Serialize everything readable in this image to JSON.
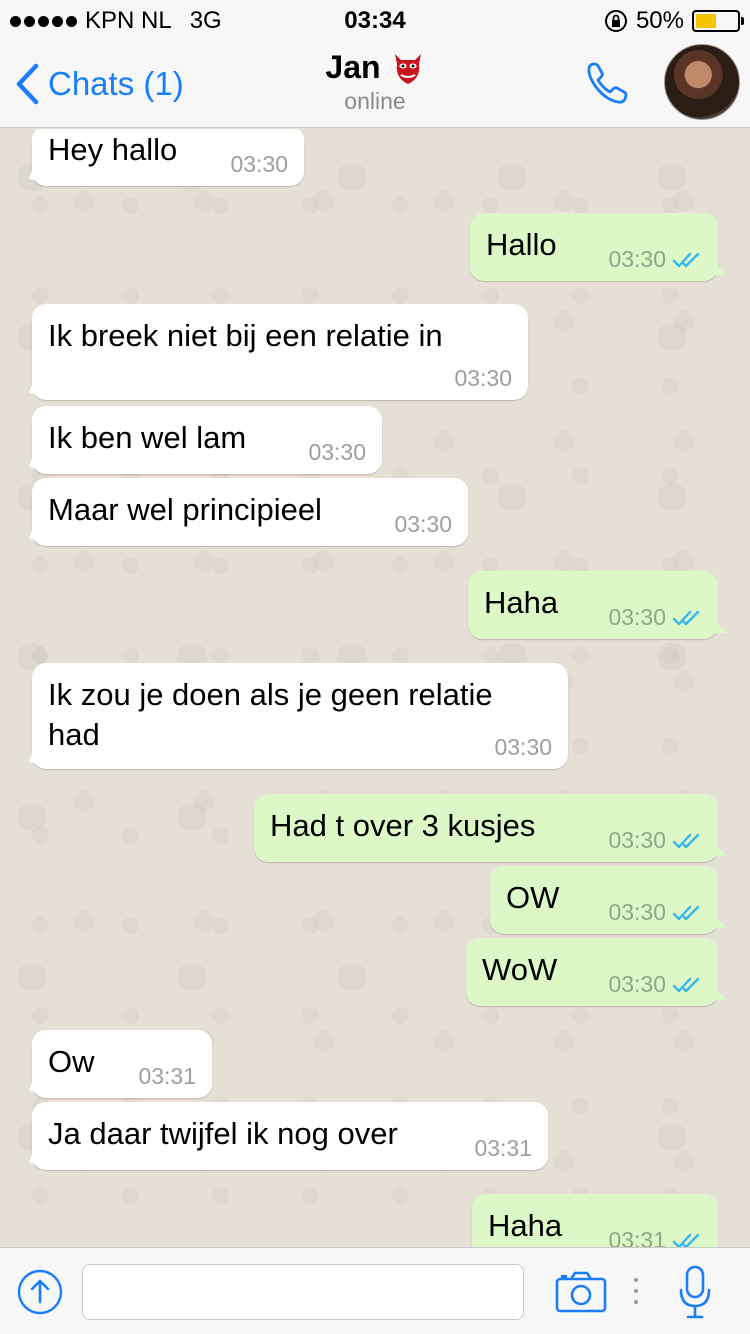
{
  "status_bar": {
    "carrier": "KPN NL",
    "network": "3G",
    "time": "03:34",
    "battery": "50%",
    "battery_level": 0.5
  },
  "header": {
    "back_label": "Chats (1)",
    "contact_name": "Jan",
    "status": "online"
  },
  "messages": [
    {
      "dir": "in",
      "text": "Hey hallo",
      "time": "03:30"
    },
    {
      "dir": "out",
      "text": "Hallo",
      "time": "03:30"
    },
    {
      "dir": "in",
      "text": "Ik breek niet bij een relatie in",
      "time": "03:30"
    },
    {
      "dir": "in",
      "text": "Ik ben wel lam",
      "time": "03:30"
    },
    {
      "dir": "in",
      "text": "Maar wel principieel",
      "time": "03:30"
    },
    {
      "dir": "out",
      "text": "Haha",
      "time": "03:30"
    },
    {
      "dir": "in",
      "text": "Ik zou je doen als je geen relatie\nhad",
      "time": "03:30"
    },
    {
      "dir": "out",
      "text": "Had t over 3 kusjes",
      "time": "03:30"
    },
    {
      "dir": "out",
      "text": "OW",
      "time": "03:30"
    },
    {
      "dir": "out",
      "text": "WoW",
      "time": "03:30"
    },
    {
      "dir": "in",
      "text": "Ow",
      "time": "03:31"
    },
    {
      "dir": "in",
      "text": "Ja daar twijfel ik nog over",
      "time": "03:31"
    },
    {
      "dir": "out",
      "text": "Haha",
      "time": "03:31"
    }
  ],
  "input": {
    "value": "",
    "placeholder": ""
  },
  "colors": {
    "accent": "#1a7efb",
    "outgoing_bubble": "#dcf8c6",
    "incoming_bubble": "#ffffff",
    "read_ticks": "#34b7f1",
    "battery_fill": "#f5c400"
  },
  "icons": [
    "back-chevron-icon",
    "call-icon",
    "share-icon",
    "camera-icon",
    "more-dots-icon",
    "microphone-icon",
    "read-receipt-icon",
    "lock-rotation-icon",
    "battery-icon"
  ]
}
